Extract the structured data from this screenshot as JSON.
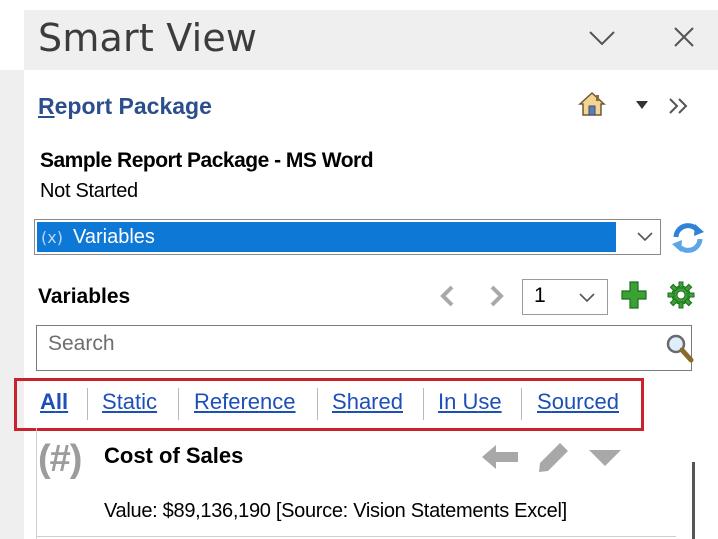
{
  "panel": {
    "title": "Smart View"
  },
  "report_package": {
    "link_label_prefix": "R",
    "link_label_rest": "eport Package",
    "name": "Sample Report Package - MS Word",
    "status": "Not Started"
  },
  "dropdown": {
    "selected": "Variables"
  },
  "variables_section": {
    "label": "Variables",
    "page_value": "1",
    "search_placeholder": "Search"
  },
  "filters": {
    "tabs": [
      {
        "pre": "",
        "acc": "A",
        "post": "ll",
        "selected": true
      },
      {
        "pre": "",
        "acc": "S",
        "post": "tatic",
        "selected": false
      },
      {
        "pre": "",
        "acc": "R",
        "post": "eference",
        "selected": false
      },
      {
        "pre": "S",
        "acc": "h",
        "post": "ared",
        "selected": false
      },
      {
        "pre": "In ",
        "acc": "U",
        "post": "se",
        "selected": false
      },
      {
        "pre": "S",
        "acc": "o",
        "post": "urced",
        "selected": false
      }
    ]
  },
  "variable_item": {
    "type_symbol": "(#)",
    "name": "Cost of Sales",
    "value_line": "Value:  $89,136,190  [Source: Vision Statements Excel]"
  },
  "colors": {
    "accent_blue": "#0e78d7",
    "link_blue": "#1d4fb8",
    "highlight_red": "#c8232c",
    "icon_green": "#3aa235"
  }
}
